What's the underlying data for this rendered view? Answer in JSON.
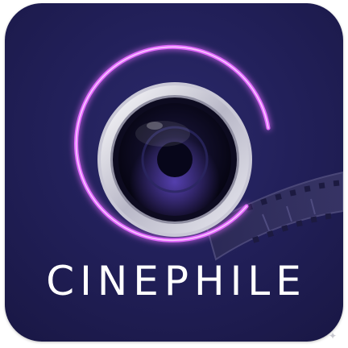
{
  "app": {
    "name": "CINEPHILE"
  },
  "icons": {
    "main": "camera-lens-icon",
    "ring": "neon-ring",
    "film": "film-strip-icon",
    "sparkle": "sparkle-icon"
  },
  "colors": {
    "background": "#22205a",
    "background_dark": "#191744",
    "neon_ring": "#e36bff",
    "lens_rim": "#d9d9e2",
    "lens_glass": "#0b0a1c",
    "lens_highlight": "#6a4fd8",
    "film_strip": "#3a3761",
    "wordmark": "#ffffff"
  }
}
